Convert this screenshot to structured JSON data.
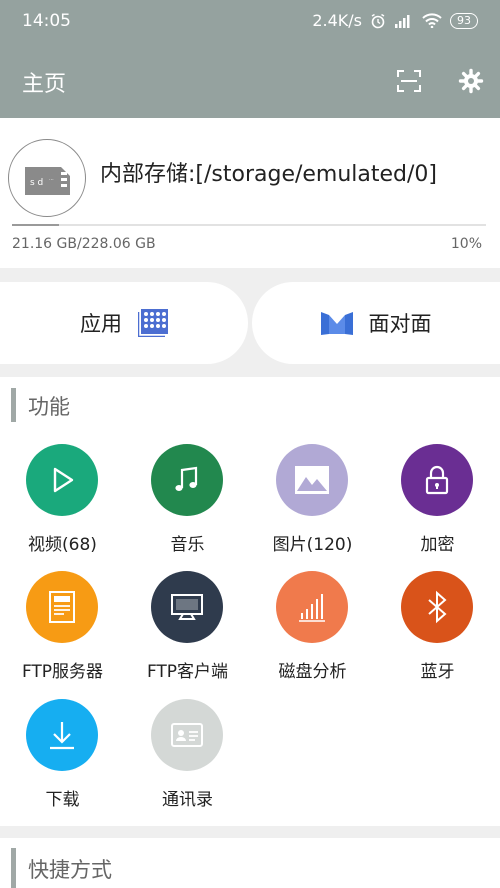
{
  "status_bar": {
    "time": "14:05",
    "net_speed": "2.4K/s",
    "battery": "93"
  },
  "app_bar": {
    "title": "主页"
  },
  "storage": {
    "label": "内部存储:[/storage/emulated/0]",
    "used_text": "21.16 GB/228.06 GB",
    "percent_text": "10%",
    "usage_fraction": 0.1
  },
  "quick": {
    "apps_label": "应用",
    "face_label": "面对面"
  },
  "functions": {
    "header": "功能",
    "items": [
      {
        "label": "视频(68)",
        "icon": "video-icon",
        "color": "#1aa97c"
      },
      {
        "label": "音乐",
        "icon": "music-icon",
        "color": "#22884e"
      },
      {
        "label": "图片(120)",
        "icon": "image-icon",
        "color": "#b1a9d5"
      },
      {
        "label": "加密",
        "icon": "lock-icon",
        "color": "#6a2e93"
      },
      {
        "label": "FTP服务器",
        "icon": "ftp-server-icon",
        "color": "#f79b14"
      },
      {
        "label": "FTP客户端",
        "icon": "ftp-client-icon",
        "color": "#2f3b4d"
      },
      {
        "label": "磁盘分析",
        "icon": "disk-analysis-icon",
        "color": "#f07a4c"
      },
      {
        "label": "蓝牙",
        "icon": "bluetooth-icon",
        "color": "#d9531a"
      },
      {
        "label": "下载",
        "icon": "download-icon",
        "color": "#16aef1"
      },
      {
        "label": "通讯录",
        "icon": "contacts-icon",
        "color": "#d4d8d6"
      }
    ]
  },
  "shortcuts": {
    "header": "快捷方式"
  }
}
